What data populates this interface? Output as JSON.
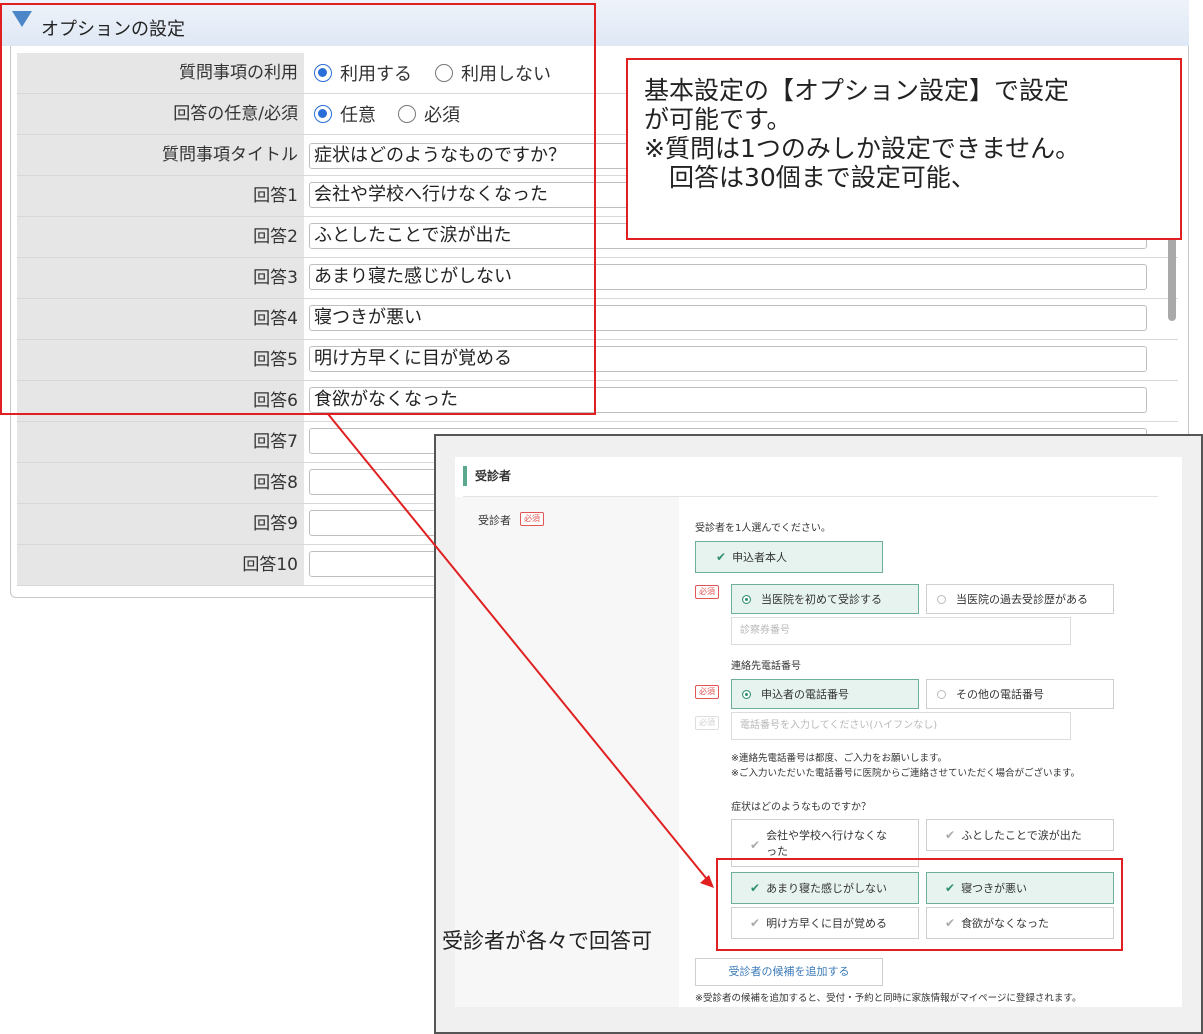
{
  "options_panel": {
    "title": "オプションの設定",
    "rows": {
      "question_use": {
        "label": "質問事項の利用",
        "options": [
          "利用する",
          "利用しない"
        ],
        "selected": "利用する"
      },
      "answer_required": {
        "label": "回答の任意/必須",
        "options": [
          "任意",
          "必須"
        ],
        "selected": "任意"
      },
      "question_title": {
        "label": "質問事項タイトル",
        "value": "症状はどのようなものですか？"
      }
    },
    "answers": [
      {
        "label": "回答1",
        "value": "会社や学校へ行けなくなった"
      },
      {
        "label": "回答2",
        "value": "ふとしたことで涙が出た"
      },
      {
        "label": "回答3",
        "value": "あまり寝た感じがしない"
      },
      {
        "label": "回答4",
        "value": "寝つきが悪い"
      },
      {
        "label": "回答5",
        "value": "明け方早くに目が覚める"
      },
      {
        "label": "回答6",
        "value": "食欲がなくなった"
      },
      {
        "label": "回答7",
        "value": ""
      },
      {
        "label": "回答8",
        "value": ""
      },
      {
        "label": "回答9",
        "value": ""
      },
      {
        "label": "回答10",
        "value": ""
      }
    ]
  },
  "note": {
    "lines": [
      "基本設定の【オプション設定】で設定",
      "が可能です。",
      "※質問は1つのみしか設定できません。",
      "　回答は30個まで設定可能、"
    ]
  },
  "patient_screen": {
    "section_title": "受診者",
    "field_label": "受診者",
    "required_tag": "必須",
    "select_prompt": "受診者を1人選んでください。",
    "applicant_button": "申込者本人",
    "visit_options": {
      "selected": "当医院を初めて受診する",
      "other": "当医院の過去受診歴がある"
    },
    "card_number_placeholder": "診察券番号",
    "phone_label": "連絡先電話番号",
    "phone_options": {
      "selected": "申込者の電話番号",
      "other": "その他の電話番号"
    },
    "phone_placeholder": "電話番号を入力してください(ハイフンなし)",
    "phone_notes": [
      "※連絡先電話番号は都度、ご入力をお願いします。",
      "※ご入力いただいた電話番号に医院からご連絡させていただく場合がございます。"
    ],
    "question_title": "症状はどのようなものですか？",
    "answers": [
      {
        "label": "会社や学校へ行けなくな\nった",
        "selected": false
      },
      {
        "label": "ふとしたことで涙が出た",
        "selected": false
      },
      {
        "label": "あまり寝た感じがしない",
        "selected": true
      },
      {
        "label": "寝つきが悪い",
        "selected": true
      },
      {
        "label": "明け方早くに目が覚める",
        "selected": false
      },
      {
        "label": "食欲がなくなった",
        "selected": false
      }
    ],
    "add_candidate_button": "受診者の候補を追加する",
    "footer_note": "※受診者の候補を追加すると、受付・予約と同時に家族情報がマイページに登録されます。"
  },
  "caption": "受診者が各々で回答可",
  "colors": {
    "highlight_red": "#e02020",
    "radio_blue": "#2a6fd8",
    "selected_green_bg": "#e6f3ee",
    "accent_green": "#5aa890"
  },
  "icons": [
    "triangle-down-icon",
    "check-icon",
    "radio-icon",
    "arrow-icon"
  ]
}
